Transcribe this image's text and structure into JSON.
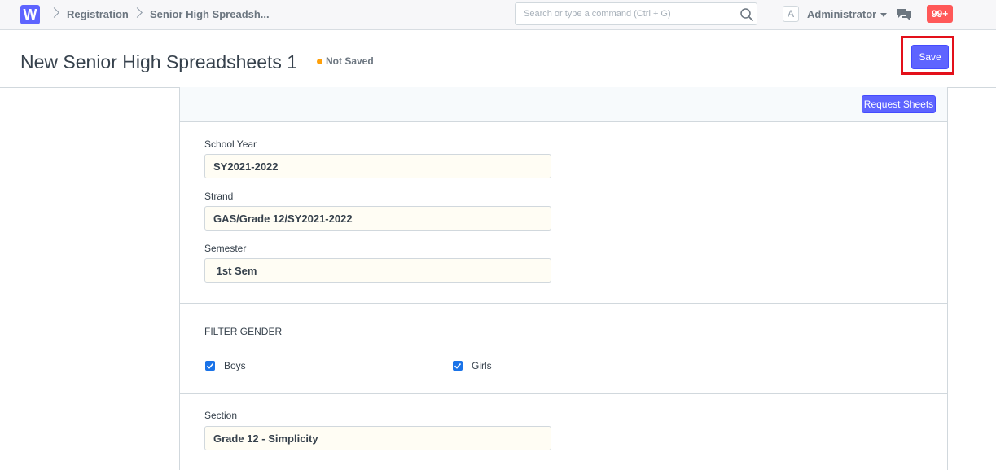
{
  "navbar": {
    "logo_letter": "W",
    "breadcrumbs": [
      "Registration",
      "Senior High Spreadsh..."
    ],
    "search_placeholder": "Search or type a command (Ctrl + G)",
    "avatar_letter": "A",
    "user_name": "Administrator",
    "notifications_count": "99+",
    "colors": {
      "brand": "#5e64ff",
      "badge": "#ff5858"
    }
  },
  "page": {
    "title": "New Senior High Spreadsheets 1",
    "status": "Not Saved",
    "status_color": "#ffa00a",
    "save_label": "Save"
  },
  "toolbar": {
    "request_sheets_label": "Request Sheets"
  },
  "form": {
    "fields": [
      {
        "label": "School Year",
        "value": "SY2021-2022"
      },
      {
        "label": "Strand",
        "value": "GAS/Grade 12/SY2021-2022"
      },
      {
        "label": "Semester",
        "value": " 1st Sem"
      }
    ],
    "filter_section": {
      "heading": "FILTER GENDER",
      "options": [
        {
          "label": "Boys",
          "checked": true
        },
        {
          "label": "Girls",
          "checked": true
        }
      ]
    },
    "section_field": {
      "label": "Section",
      "value": "Grade 12 - Simplicity"
    }
  }
}
